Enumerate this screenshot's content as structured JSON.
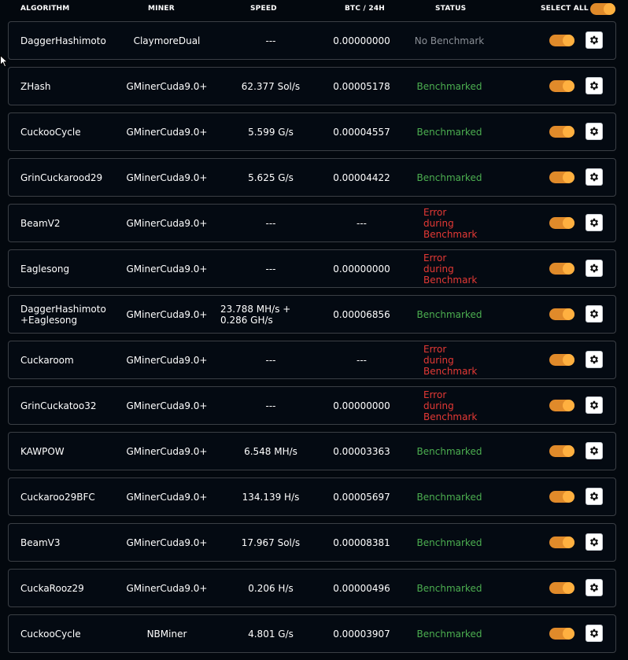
{
  "header": {
    "algorithm": "ALGORITHM",
    "miner": "MINER",
    "speed": "SPEED",
    "btc": "BTC / 24H",
    "status": "STATUS",
    "select_all": "SELECT ALL",
    "select_all_on": true
  },
  "colors": {
    "accent": "#e08a2a",
    "benchmarked": "#4caf50",
    "error": "#e53935",
    "no_benchmark": "#8a8f96"
  },
  "rows": [
    {
      "algorithm": "DaggerHashimoto",
      "miner": "ClaymoreDual",
      "speed": "---",
      "btc": "0.00000000",
      "status": "No Benchmark",
      "status_type": "none",
      "enabled": true
    },
    {
      "algorithm": "ZHash",
      "miner": "GMinerCuda9.0+",
      "speed": "62.377 Sol/s",
      "btc": "0.00005178",
      "status": "Benchmarked",
      "status_type": "ok",
      "enabled": true
    },
    {
      "algorithm": "CuckooCycle",
      "miner": "GMinerCuda9.0+",
      "speed": "5.599 G/s",
      "btc": "0.00004557",
      "status": "Benchmarked",
      "status_type": "ok",
      "enabled": true
    },
    {
      "algorithm": "GrinCuckarood29",
      "miner": "GMinerCuda9.0+",
      "speed": "5.625 G/s",
      "btc": "0.00004422",
      "status": "Benchmarked",
      "status_type": "ok",
      "enabled": true
    },
    {
      "algorithm": "BeamV2",
      "miner": "GMinerCuda9.0+",
      "speed": "---",
      "btc": "---",
      "status": "Error during Benchmark",
      "status_type": "err",
      "enabled": true
    },
    {
      "algorithm": "Eaglesong",
      "miner": "GMinerCuda9.0+",
      "speed": "---",
      "btc": "0.00000000",
      "status": "Error during Benchmark",
      "status_type": "err",
      "enabled": true
    },
    {
      "algorithm": "DaggerHashimoto +Eaglesong",
      "miner": "GMinerCuda9.0+",
      "speed": "23.788 MH/s + 0.286 GH/s",
      "btc": "0.00006856",
      "status": "Benchmarked",
      "status_type": "ok",
      "enabled": true
    },
    {
      "algorithm": "Cuckaroom",
      "miner": "GMinerCuda9.0+",
      "speed": "---",
      "btc": "---",
      "status": "Error during Benchmark",
      "status_type": "err",
      "enabled": true
    },
    {
      "algorithm": "GrinCuckatoo32",
      "miner": "GMinerCuda9.0+",
      "speed": "---",
      "btc": "0.00000000",
      "status": "Error during Benchmark",
      "status_type": "err",
      "enabled": true
    },
    {
      "algorithm": "KAWPOW",
      "miner": "GMinerCuda9.0+",
      "speed": "6.548 MH/s",
      "btc": "0.00003363",
      "status": "Benchmarked",
      "status_type": "ok",
      "enabled": true
    },
    {
      "algorithm": "Cuckaroo29BFC",
      "miner": "GMinerCuda9.0+",
      "speed": "134.139 H/s",
      "btc": "0.00005697",
      "status": "Benchmarked",
      "status_type": "ok",
      "enabled": true
    },
    {
      "algorithm": "BeamV3",
      "miner": "GMinerCuda9.0+",
      "speed": "17.967 Sol/s",
      "btc": "0.00008381",
      "status": "Benchmarked",
      "status_type": "ok",
      "enabled": true
    },
    {
      "algorithm": "CuckaRooz29",
      "miner": "GMinerCuda9.0+",
      "speed": "0.206 H/s",
      "btc": "0.00000496",
      "status": "Benchmarked",
      "status_type": "ok",
      "enabled": true
    },
    {
      "algorithm": "CuckooCycle",
      "miner": "NBMiner",
      "speed": "4.801 G/s",
      "btc": "0.00003907",
      "status": "Benchmarked",
      "status_type": "ok",
      "enabled": true
    }
  ]
}
